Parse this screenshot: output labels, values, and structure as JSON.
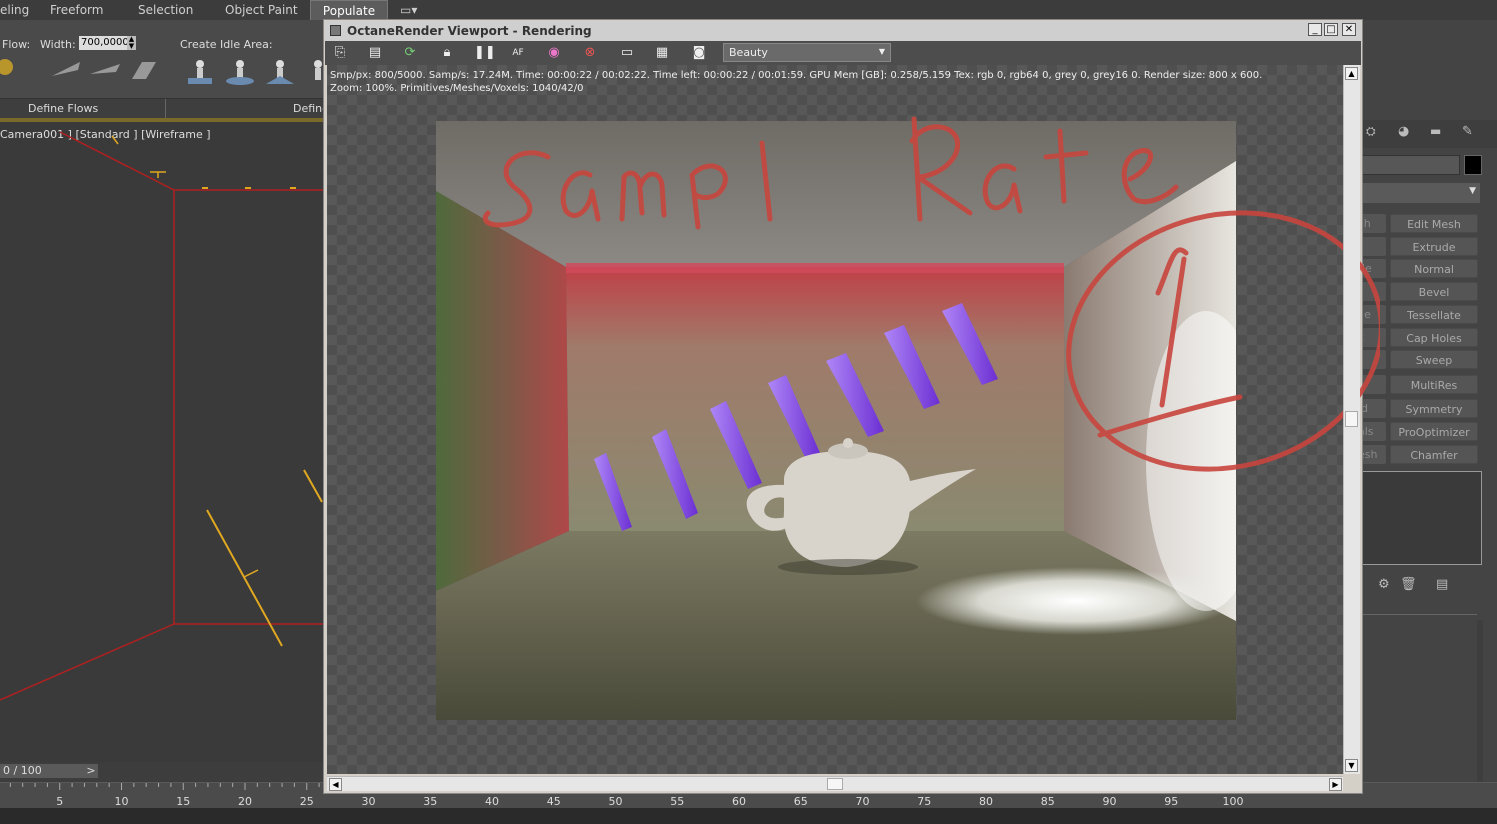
{
  "ribbon": {
    "tabs": [
      "eling",
      "Freeform",
      "Selection",
      "Object Paint",
      "Populate"
    ],
    "flow_label": "Flow:",
    "width_label": "Width:",
    "width_value": "700,0000",
    "create_idle_label": "Create Idle Area:",
    "define_flows": "Define Flows",
    "define_idle": "Define"
  },
  "viewport": {
    "label": "Camera001 ] [Standard ] [Wireframe ]"
  },
  "timeline": {
    "frame": "0 / 100",
    "next": ">",
    "ticks": [
      "5",
      "10",
      "15",
      "20",
      "25",
      "30",
      "35",
      "40",
      "45",
      "50",
      "55",
      "60",
      "65",
      "70",
      "75",
      "80",
      "85",
      "90",
      "95",
      "100"
    ]
  },
  "octane": {
    "title": "OctaneRender Viewport - Rendering",
    "pass_select": "Beauty",
    "stats_line1": "Smp/px: 800/5000.   Samp/s: 17.24M.   Time: 00:00:22 / 00:02:22.   Time left: 00:00:22 / 00:01:59.   GPU Mem [GB]: 0.258/5.159   Tex: rgb 0, rgb64 0, grey 0, grey16 0.   Render size: 800 x 600.",
    "stats_line2": "Zoom: 100%.   Primitives/Meshes/Voxels: 1040/42/0",
    "annotation_text": "samp l Rate",
    "annotation_number": "1",
    "toolbar_icons": [
      "copy-icon",
      "clipboard-icon",
      "refresh-icon",
      "lock-icon",
      "pause-icon",
      "af-icon",
      "color-icon",
      "target-icon",
      "screen-icon",
      "film-icon",
      "camera-icon"
    ],
    "win_min": "_",
    "win_max": "□",
    "win_close": "✕"
  },
  "modifiers": {
    "buttons": [
      "Edit Mesh",
      "Extrude",
      "Normal",
      "Bevel",
      "Tessellate",
      "Cap Holes",
      "Sweep",
      "MultiRes",
      "Symmetry",
      "ProOptimizer",
      "Chamfer"
    ],
    "stubs": [
      "sh",
      "",
      "de",
      "",
      "ile",
      "c",
      "",
      "",
      "ld",
      "als",
      "esh"
    ]
  },
  "colors": {
    "annotation": "#c8463e",
    "neon": "#9a5cff",
    "wire": "#e0a820",
    "frame_red": "#b02020"
  }
}
